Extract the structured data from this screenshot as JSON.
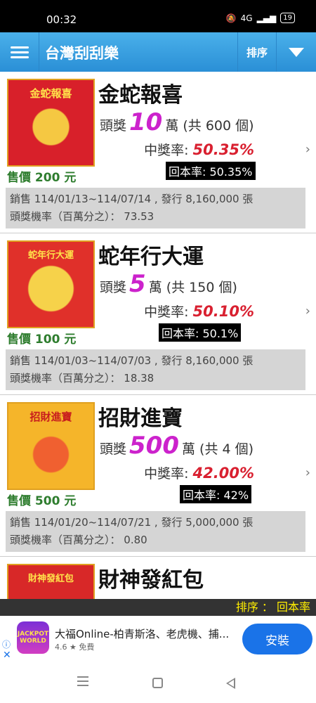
{
  "status_bar": {
    "time": "00:32",
    "net": "4G",
    "battery": "19"
  },
  "app_bar": {
    "title": "台灣刮刮樂",
    "sort_label": "排序"
  },
  "tickets": [
    {
      "name": "金蛇報喜",
      "prize_prefix": "頭獎",
      "prize_amount": "10",
      "prize_suffix": "萬 (共 600 個)",
      "win_rate_label": "中獎率:",
      "win_rate": "50.35%",
      "return_rate": "回本率: 50.35%",
      "price": "售價 200 元",
      "sales": "銷售 114/01/13~114/07/14 , 發行 8,160,000 張",
      "jackpot_odds": "頭獎機率（百萬分之）： 73.53",
      "thumb_text": "金蛇報喜",
      "thumb_color": "#d8202a"
    },
    {
      "name": "蛇年行大運",
      "prize_prefix": "頭獎",
      "prize_amount": "5",
      "prize_suffix": "萬 (共 150 個)",
      "win_rate_label": "中獎率:",
      "win_rate": "50.10%",
      "return_rate": "回本率: 50.1%",
      "price": "售價 100 元",
      "sales": "銷售 114/01/03~114/07/03 , 發行 8,160,000 張",
      "jackpot_odds": "頭獎機率（百萬分之）： 18.38",
      "thumb_text": "蛇年行大運",
      "thumb_color": "#e0302a"
    },
    {
      "name": "招財進寶",
      "prize_prefix": "頭獎",
      "prize_amount": "500",
      "prize_suffix": "萬 (共 4 個)",
      "win_rate_label": "中獎率:",
      "win_rate": "42.00%",
      "return_rate": "回本率: 42%",
      "price": "售價 500 元",
      "sales": "銷售 114/01/20~114/07/21 , 發行 5,000,000 張",
      "jackpot_odds": "頭獎機率（百萬分之）： 0.80",
      "thumb_text": "招財進寶",
      "thumb_color": "#f0a020"
    },
    {
      "name": "財神發紅包",
      "thumb_text": "財神發紅包",
      "thumb_color": "#d82828"
    }
  ],
  "sort_footer": "排序 ： 回本率",
  "ad": {
    "icon_text": "JACKPOT WORLD",
    "title": "大福Online-柏青斯洛、老虎機、捕...",
    "rating": "4.6 ★ 免費",
    "install": "安裝",
    "info_icon": "ⓘ",
    "close_icon": "✕"
  }
}
